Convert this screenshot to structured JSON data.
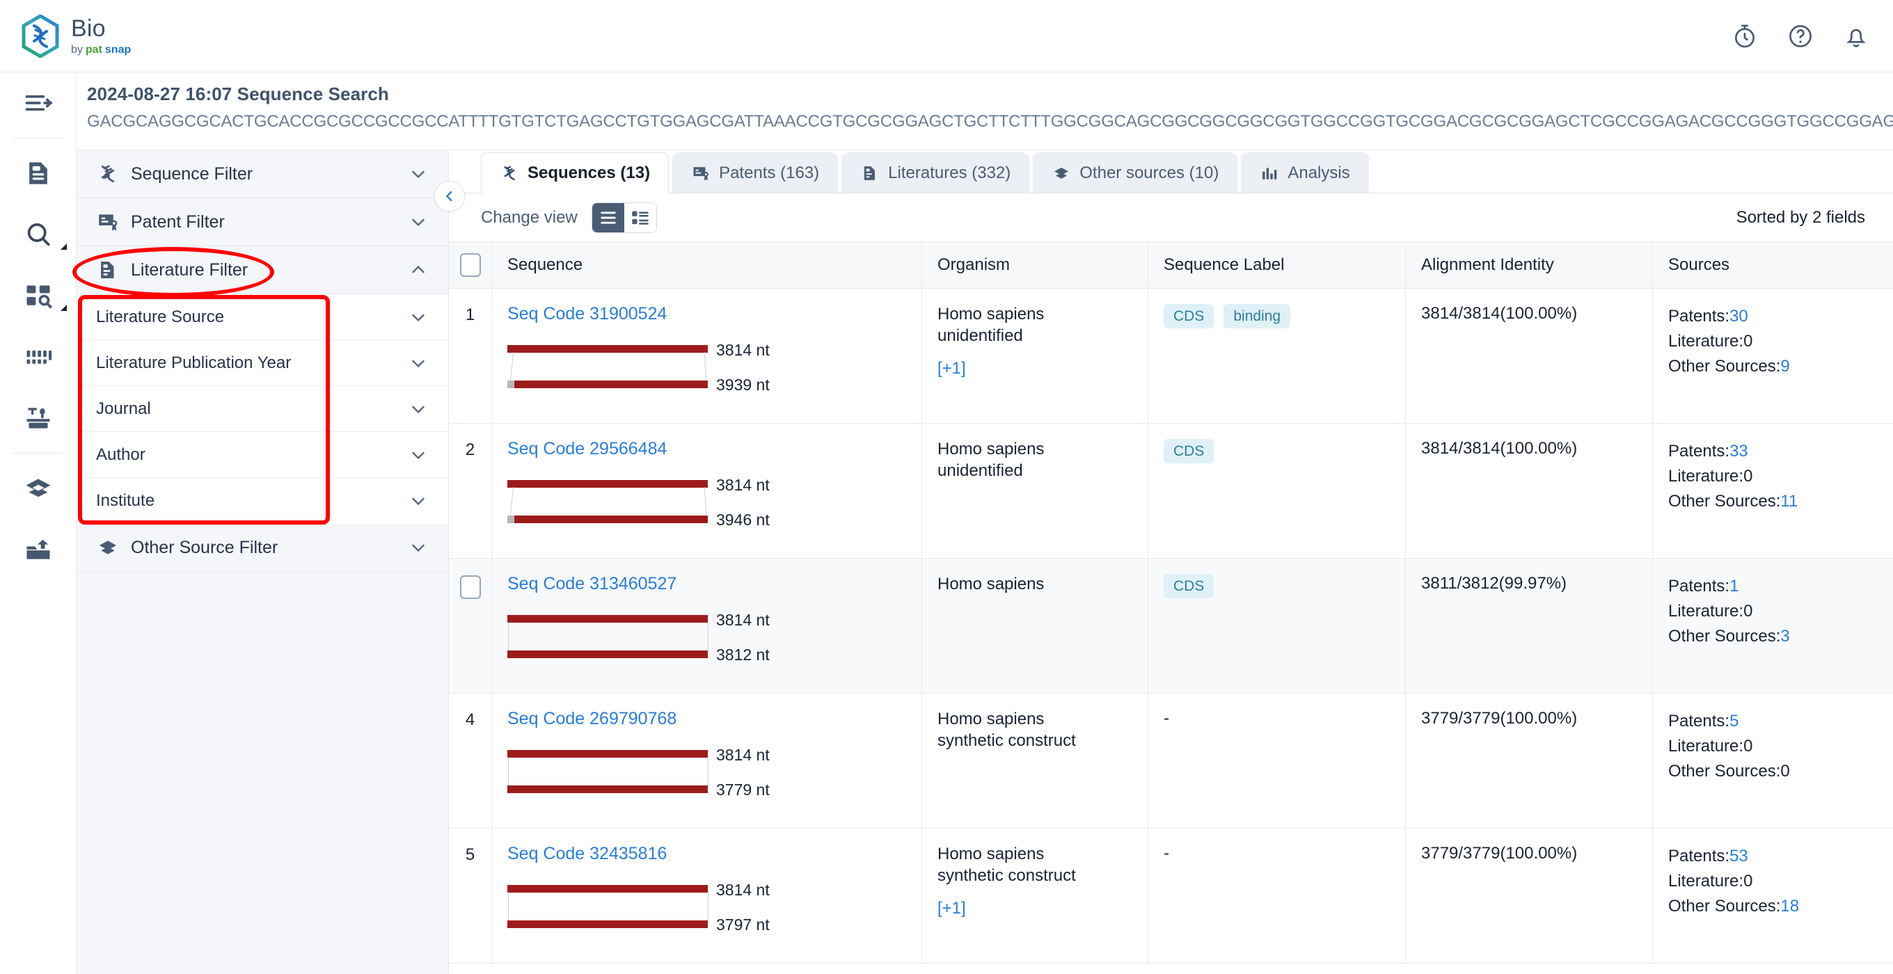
{
  "brand": {
    "title": "Bio",
    "by": "by",
    "patsnap_a": "pat",
    "patsnap_b": "snap"
  },
  "topbar": {
    "icons": [
      {
        "name": "history-timer-icon",
        "label": "History"
      },
      {
        "name": "help-icon",
        "label": "Help"
      },
      {
        "name": "notifications-bell-icon",
        "label": "Notifications"
      }
    ]
  },
  "rail": {
    "items": [
      {
        "name": "expand-nav-icon",
        "label": "Expand navigation"
      },
      {
        "name": "document-icon",
        "label": "Documents"
      },
      {
        "name": "search-icon",
        "label": "Search"
      },
      {
        "name": "grid-search-icon",
        "label": "Grid Search"
      },
      {
        "name": "columns-icon",
        "label": "Columns"
      },
      {
        "name": "tools-icon",
        "label": "Tools"
      },
      {
        "name": "layers-icon",
        "label": "Layers"
      },
      {
        "name": "upload-inbox-icon",
        "label": "Upload"
      }
    ]
  },
  "search_header": {
    "title": "2024-08-27 16:07 Sequence Search",
    "sequence": "GACGCAGGCGCACTGCACCGCGCCGCCGCCATTTTGTGTCTGAGCCTGTGGAGCGATTAAACCGTGCGCGGAGCTGCTTCTTTGGCGGCAGCGGCGGCGGCGGTGGCCGGTGCGGACGCGCGGAGCTCGCCGGAGACGCCGGGTGGCCGGAGCG"
  },
  "filters": {
    "groups": [
      {
        "label": "Sequence Filter",
        "icon": "dna-icon",
        "expanded": false
      },
      {
        "label": "Patent Filter",
        "icon": "patent-icon",
        "expanded": false
      },
      {
        "label": "Literature Filter",
        "icon": "literature-icon",
        "expanded": true,
        "children": [
          {
            "label": "Literature Source"
          },
          {
            "label": "Literature Publication Year"
          },
          {
            "label": "Journal"
          },
          {
            "label": "Author"
          },
          {
            "label": "Institute"
          }
        ]
      },
      {
        "label": "Other Source Filter",
        "icon": "other-source-icon",
        "expanded": false
      }
    ]
  },
  "annotations": {
    "color": "#ff0000",
    "ellipse_target": "Literature Filter",
    "rect_target": "literature-sub-filters"
  },
  "collapse_handle": {
    "name": "collapse-sidebar-handle",
    "glyph": "‹"
  },
  "tabs": [
    {
      "label": "Sequences (13)",
      "icon": "dna-icon",
      "active": true
    },
    {
      "label": "Patents (163)",
      "icon": "patent-icon",
      "active": false
    },
    {
      "label": "Literatures (332)",
      "icon": "literature-icon",
      "active": false
    },
    {
      "label": "Other sources (10)",
      "icon": "other-source-icon",
      "active": false
    },
    {
      "label": "Analysis",
      "icon": "bar-chart-icon",
      "active": false
    }
  ],
  "toolbar": {
    "change_view_label": "Change view",
    "view_list_name": "list-view-button",
    "view_card_name": "card-view-button",
    "sorted_label": "Sorted by 2 fields"
  },
  "table": {
    "columns": [
      "Sequence",
      "Organism",
      "Sequence Label",
      "Alignment Identity",
      "Sources"
    ],
    "rows": [
      {
        "index": "1",
        "show_checkbox": false,
        "hovered": false,
        "seq_code": "Seq Code 31900524",
        "query_nt": "3814 nt",
        "subject_nt": "3939 nt",
        "bar_skew": "slanted",
        "organism": [
          "Homo sapiens",
          "unidentified"
        ],
        "plus_more": "[+1]",
        "labels": [
          "CDS",
          "binding"
        ],
        "alignment": "3814/3814(100.00%)",
        "sources": {
          "patents_label": "Patents:",
          "patents": "30",
          "literature_label": "Literature:",
          "literature": "0",
          "other_label": "Other Sources:",
          "other": "9"
        }
      },
      {
        "index": "2",
        "show_checkbox": false,
        "hovered": false,
        "seq_code": "Seq Code 29566484",
        "query_nt": "3814 nt",
        "subject_nt": "3946 nt",
        "bar_skew": "slanted",
        "organism": [
          "Homo sapiens",
          "unidentified"
        ],
        "plus_more": "",
        "labels": [
          "CDS"
        ],
        "alignment": "3814/3814(100.00%)",
        "sources": {
          "patents_label": "Patents:",
          "patents": "33",
          "literature_label": "Literature:",
          "literature": "0",
          "other_label": "Other Sources:",
          "other": "11"
        }
      },
      {
        "index": "3",
        "show_checkbox": true,
        "hovered": true,
        "seq_code": "Seq Code 313460527",
        "query_nt": "3814 nt",
        "subject_nt": "3812 nt",
        "bar_skew": "straight",
        "organism": [
          "Homo sapiens"
        ],
        "plus_more": "",
        "labels": [
          "CDS"
        ],
        "alignment": "3811/3812(99.97%)",
        "sources": {
          "patents_label": "Patents:",
          "patents": "1",
          "literature_label": "Literature:",
          "literature": "0",
          "other_label": "Other Sources:",
          "other": "3"
        }
      },
      {
        "index": "4",
        "show_checkbox": false,
        "hovered": false,
        "seq_code": "Seq Code 269790768",
        "query_nt": "3814 nt",
        "subject_nt": "3779 nt",
        "bar_skew": "straight",
        "organism": [
          "Homo sapiens",
          "synthetic construct"
        ],
        "plus_more": "",
        "labels": [],
        "label_dash": "-",
        "alignment": "3779/3779(100.00%)",
        "sources": {
          "patents_label": "Patents:",
          "patents": "5",
          "literature_label": "Literature:",
          "literature": "0",
          "other_label": "Other Sources:",
          "other": "0"
        }
      },
      {
        "index": "5",
        "show_checkbox": false,
        "hovered": false,
        "seq_code": "Seq Code 32435816",
        "query_nt": "3814 nt",
        "subject_nt": "3797 nt",
        "bar_skew": "straight",
        "organism": [
          "Homo sapiens",
          "synthetic construct"
        ],
        "plus_more": "[+1]",
        "labels": [],
        "label_dash": "-",
        "alignment": "3779/3779(100.00%)",
        "sources": {
          "patents_label": "Patents:",
          "patents": "53",
          "literature_label": "Literature:",
          "literature": "0",
          "other_label": "Other Sources:",
          "other": "18"
        }
      }
    ]
  },
  "colors": {
    "accent_blue": "#2a7ddc",
    "bar_red": "#9e1b1b",
    "chip_bg": "#dff1f7",
    "chip_fg": "#2e7e9b",
    "annotation_red": "#ff0000"
  }
}
